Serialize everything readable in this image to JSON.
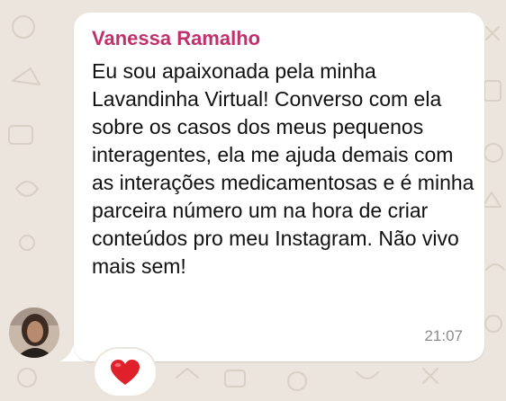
{
  "message": {
    "sender": "Vanessa Ramalho",
    "text": "Eu sou apaixonada pela minha Lavandinha Virtual! Converso com ela sobre os casos dos meus pequenos interagentes, ela me ajuda demais com as interações medicamentosas e é minha parceira número um na hora de criar conteúdos pro meu Instagram. Não vivo mais sem!",
    "time": "21:07",
    "reaction": "heart-emoji"
  },
  "colors": {
    "background": "#ece5dd",
    "bubble": "#ffffff",
    "sender": "#c2306c",
    "timestamp": "#8a8a8a",
    "heart": "#e0202a"
  },
  "icons": {
    "avatar": "user-photo",
    "reaction": "heart-icon"
  }
}
